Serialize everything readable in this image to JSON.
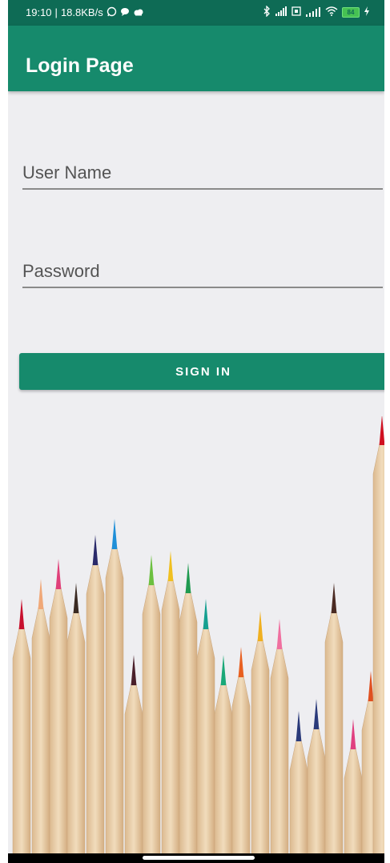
{
  "status_bar": {
    "time": "19:10",
    "network_speed": "18.8KB/s",
    "battery_level": "84",
    "icons_left": [
      "whatsapp-icon",
      "chat-icon",
      "cloud-icon"
    ],
    "icons_right": [
      "bluetooth-icon",
      "signal-icon",
      "sim-icon",
      "signal-5g-icon",
      "wifi-icon",
      "battery-icon",
      "charging-icon"
    ]
  },
  "app_bar": {
    "title": "Login Page",
    "color": "#168a6c"
  },
  "login_form": {
    "username_placeholder": "User Name",
    "password_placeholder": "Password",
    "signin_label": "SIGN IN"
  },
  "background": {
    "image": "colored-pencils"
  },
  "colors": {
    "primary": "#168a6c",
    "status_bar": "#0e6b55",
    "background": "#eeeef1"
  }
}
